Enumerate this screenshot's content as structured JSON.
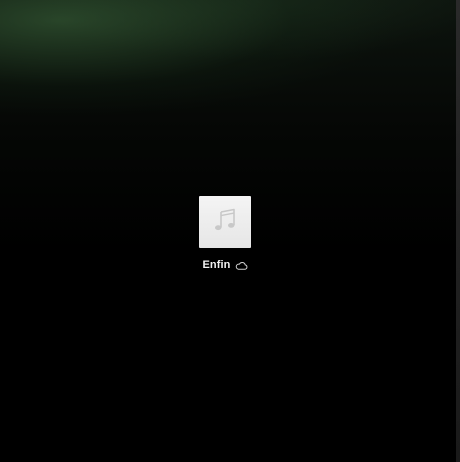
{
  "desktop": {
    "items": [
      {
        "name": "Enfin",
        "icon": "music-note-icon",
        "status_icon": "icloud-icon",
        "thumb_color": "#eeeeee",
        "glyph_color": "#c8c8c8"
      }
    ]
  }
}
